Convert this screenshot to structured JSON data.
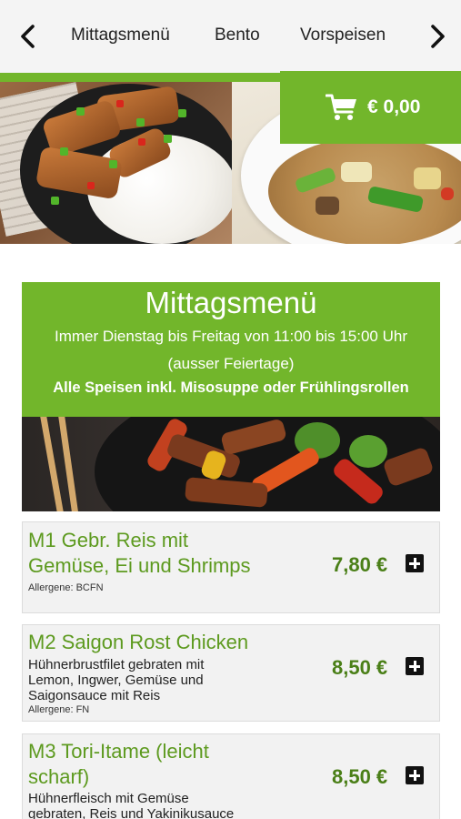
{
  "nav": {
    "prev_icon": "chevron-left-icon",
    "next_icon": "chevron-right-icon",
    "tabs": [
      {
        "label": "Mittagsmenü"
      },
      {
        "label": "Bento"
      },
      {
        "label": "Vorspeisen"
      }
    ]
  },
  "cart": {
    "icon": "shopping-cart-icon",
    "total": "€ 0,00"
  },
  "menu": {
    "title": "Mittagsmenü",
    "hours": "Immer Dienstag bis Freitag von 11:00 bis 15:00 Uhr",
    "note": "(ausser Feiertage)",
    "included": "Alle Speisen inkl. Misosuppe oder Frühlingsrollen"
  },
  "items": [
    {
      "name_line1": "M1 Gebr. Reis mit",
      "name_line2": "Gemüse, Ei und Shrimps",
      "desc_line1": "",
      "desc_line2": "",
      "desc_line3": "",
      "allergen": "Allergene: BCFN",
      "price": "7,80 €"
    },
    {
      "name_line1": "M2 Saigon Rost Chicken",
      "name_line2": "",
      "desc_line1": "Hühnerbrustfilet gebraten mit",
      "desc_line2": "Lemon, Ingwer, Gemüse und",
      "desc_line3": "Saigonsauce mit Reis",
      "allergen": "Allergene: FN",
      "price": "8,50 €"
    },
    {
      "name_line1": "M3 Tori-Itame (leicht",
      "name_line2": "scharf)",
      "desc_line1": "Hühnerfleisch mit Gemüse",
      "desc_line2": "gebraten, Reis und Yakinikusauce",
      "desc_line3": "",
      "allergen": "",
      "price": "8,50 €"
    }
  ],
  "colors": {
    "brand_green": "#72b62b",
    "item_title_green": "#5d9a1f",
    "price_green": "#4a7f17"
  }
}
